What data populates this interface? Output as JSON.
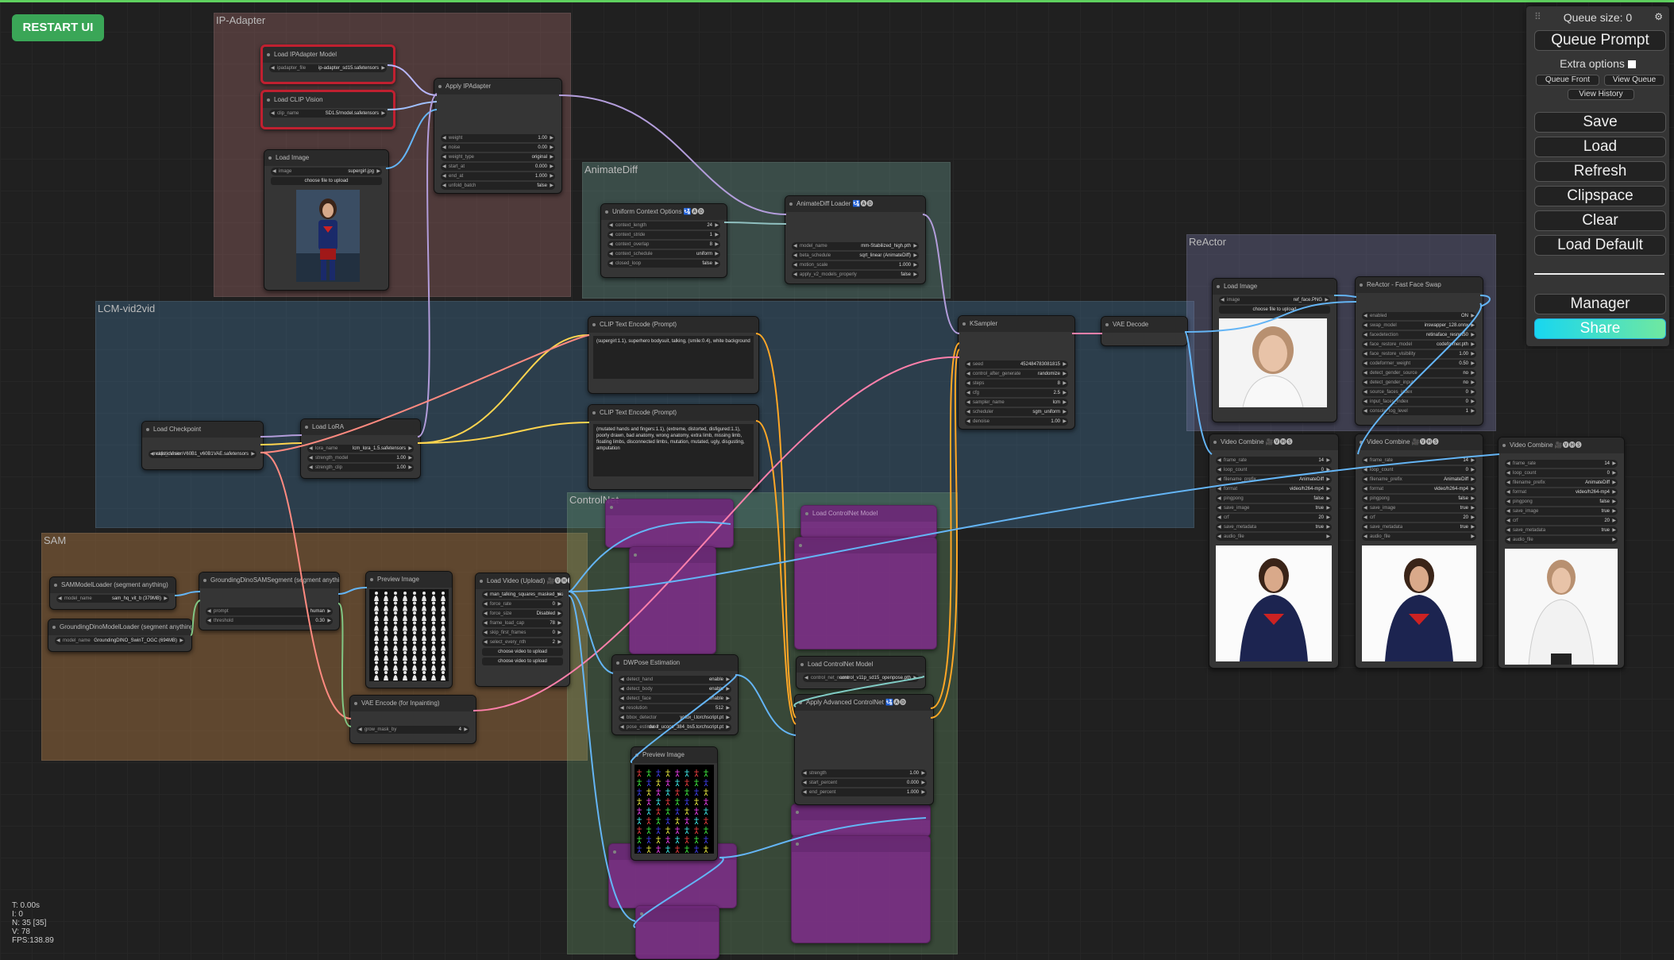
{
  "topbar": {
    "restart_label": "RESTART UI"
  },
  "menu": {
    "queue_size": "Queue size: 0",
    "queue_prompt": "Queue Prompt",
    "extra_options": "Extra options",
    "queue_front": "Queue Front",
    "view_queue": "View Queue",
    "view_history": "View History",
    "save": "Save",
    "load": "Load",
    "refresh": "Refresh",
    "clipspace": "Clipspace",
    "clear": "Clear",
    "load_default": "Load Default",
    "manager": "Manager",
    "share": "Share"
  },
  "groups": {
    "ip_adapter": "IP-Adapter",
    "animatediff": "AnimateDiff",
    "lcm": "LCM-vid2vid",
    "reactor": "ReActor",
    "sam": "SAM",
    "controlnet": "ControlNet"
  },
  "nodes": {
    "load_ipadapter_model": {
      "title": "Load IPAdapter Model",
      "w1k": "ipadapter_file",
      "w1v": "ip-adapter_sd15.safetensors"
    },
    "load_clip_vision": {
      "title": "Load CLIP Vision",
      "w1k": "clip_name",
      "w1v": "SD1.5/model.safetensors"
    },
    "load_image_ip": {
      "title": "Load Image",
      "w1k": "image",
      "w1v": "supergirl.jpg",
      "btn": "choose file to upload"
    },
    "apply_ipadapter": {
      "title": "Apply IPAdapter",
      "w": [
        [
          "weight",
          "1.00"
        ],
        [
          "noise",
          "0.00"
        ],
        [
          "weight_type",
          "original"
        ],
        [
          "start_at",
          "0.000"
        ],
        [
          "end_at",
          "1.000"
        ],
        [
          "unfold_batch",
          "false"
        ]
      ]
    },
    "uniform_context": {
      "title": "Uniform Context Options 🛂🅐🅓",
      "w": [
        [
          "context_length",
          "24"
        ],
        [
          "context_stride",
          "1"
        ],
        [
          "context_overlap",
          "8"
        ],
        [
          "context_schedule",
          "uniform"
        ],
        [
          "closed_loop",
          "false"
        ]
      ]
    },
    "animatediff_loader": {
      "title": "AnimateDiff Loader 🛂🅐🅓",
      "w": [
        [
          "model_name",
          "mm-Stabilized_high.pth"
        ],
        [
          "beta_schedule",
          "sqrt_linear (AnimateDiff)"
        ],
        [
          "motion_scale",
          "1.000"
        ],
        [
          "apply_v2_models_properly",
          "false"
        ]
      ]
    },
    "clip_text_pos": {
      "title": "CLIP Text Encode (Prompt)",
      "text": "(supergirl:1.1), superhero bodysuit, talking, (smile:0.4), white background"
    },
    "clip_text_neg": {
      "title": "CLIP Text Encode (Prompt)",
      "text": "(mutated hands and fingers:1.1), (extreme, distorted, disfigured:1.1), poorly drawn, bad anatomy, wrong anatomy, extra limb, missing limb, floating limbs, disconnected limbs, mutation, mutated, ugly, disgusting, amputation"
    },
    "ksampler": {
      "title": "KSampler",
      "w": [
        [
          "seed",
          "452484783081815"
        ],
        [
          "control_after_generate",
          "randomize"
        ],
        [
          "steps",
          "8"
        ],
        [
          "cfg",
          "2.5"
        ],
        [
          "sampler_name",
          "lcm"
        ],
        [
          "scheduler",
          "sgm_uniform"
        ],
        [
          "denoise",
          "1.00"
        ]
      ]
    },
    "vae_decode": {
      "title": "VAE Decode"
    },
    "load_checkpoint": {
      "title": "Load Checkpoint",
      "w1k": "ckpt_name",
      "w1v": "realisticVisionV60B1_v60B1VAE.safetensors"
    },
    "load_lora": {
      "title": "Load LoRA",
      "w": [
        [
          "lora_name",
          "lcm_lora_1.5.safetensors"
        ],
        [
          "strength_model",
          "1.00"
        ],
        [
          "strength_clip",
          "1.00"
        ]
      ]
    },
    "reactor_load_image": {
      "title": "Load Image",
      "w1k": "image",
      "w1v": "ref_face.PNG",
      "btn": "choose file to upload"
    },
    "reactor_fast": {
      "title": "ReActor - Fast Face Swap",
      "w": [
        [
          "enabled",
          "ON"
        ],
        [
          "swap_model",
          "inswapper_128.onnx"
        ],
        [
          "facedetection",
          "retinaface_resnet50"
        ],
        [
          "face_restore_model",
          "codeformer.pth"
        ],
        [
          "face_restore_visibility",
          "1.00"
        ],
        [
          "codeformer_weight",
          "0.50"
        ],
        [
          "detect_gender_source",
          "no"
        ],
        [
          "detect_gender_input",
          "no"
        ],
        [
          "source_faces_index",
          "0"
        ],
        [
          "input_faces_index",
          "0"
        ],
        [
          "console_log_level",
          "1"
        ]
      ]
    },
    "video_combine_1": {
      "title": "Video Combine 🎥🅥🅗🅢"
    },
    "video_combine_2": {
      "title": "Video Combine 🎥🅥🅗🅢"
    },
    "video_combine_3": {
      "title": "Video Combine 🎥🅥🅗🅢"
    },
    "video_combine_w": [
      [
        "frame_rate",
        "14"
      ],
      [
        "loop_count",
        "0"
      ],
      [
        "filename_prefix",
        "AnimateDiff"
      ],
      [
        "format",
        "video/h264-mp4"
      ],
      [
        "pingpong",
        "false"
      ],
      [
        "save_image",
        "true"
      ],
      [
        "crf",
        "20"
      ],
      [
        "save_metadata",
        "true"
      ],
      [
        "audio_file",
        ""
      ]
    ],
    "sam_loader": {
      "title": "SAMModelLoader (segment anything)",
      "w1k": "model_name",
      "w1v": "sam_hq_vit_b (379MB)"
    },
    "gdino_loader": {
      "title": "GroundingDinoModelLoader (segment anything)",
      "w1k": "model_name",
      "w1v": "GroundingDINO_SwinT_OGC (694MB)"
    },
    "gdino_sam": {
      "title": "GroundingDinoSAMSegment (segment anything)",
      "w": [
        [
          "prompt",
          "human"
        ],
        [
          "threshold",
          "0.30"
        ]
      ]
    },
    "preview_image_1": {
      "title": "Preview Image"
    },
    "load_video": {
      "title": "Load Video (Upload) 🎥🅥🅗🅢",
      "w": [
        [
          "video",
          "man_talking_squares_masked_video.mp4"
        ],
        [
          "force_rate",
          "0"
        ],
        [
          "force_size",
          "Disabled"
        ],
        [
          "frame_load_cap",
          "78"
        ],
        [
          "skip_first_frames",
          "0"
        ],
        [
          "select_every_nth",
          "2"
        ]
      ],
      "btn1": "choose video to upload",
      "btn2": "choose video to upload"
    },
    "vae_encode_inpaint": {
      "title": "VAE Encode (for Inpainting)",
      "w": [
        [
          "grow_mask_by",
          "4"
        ]
      ]
    },
    "dwpose": {
      "title": "DWPose Estimation",
      "w": [
        [
          "detect_hand",
          "enable"
        ],
        [
          "detect_body",
          "enable"
        ],
        [
          "detect_face",
          "enable"
        ],
        [
          "resolution",
          "512"
        ],
        [
          "bbox_detector",
          "yolox_l.torchscript.pt"
        ],
        [
          "pose_estimator",
          "dw-ll_ucoco_384_bs5.torchscript.pt"
        ]
      ]
    },
    "preview_image_2": {
      "title": "Preview Image"
    },
    "load_controlnet": {
      "title": "Load ControlNet Model",
      "w1k": "control_net_name",
      "w1v": "control_v11p_sd15_openpose.pth"
    },
    "apply_adv_controlnet": {
      "title": "Apply Advanced ControlNet 🛂🅐🅓",
      "w": [
        [
          "strength",
          "1.00"
        ],
        [
          "start_percent",
          "0.000"
        ],
        [
          "end_percent",
          "1.000"
        ]
      ]
    },
    "ghost_title": "Load ControlNet Model"
  },
  "stats": {
    "t": "T: 0.00s",
    "i": "I: 0",
    "n": "N: 35 [35]",
    "v": "V: 78",
    "fps": "FPS:138.89"
  }
}
